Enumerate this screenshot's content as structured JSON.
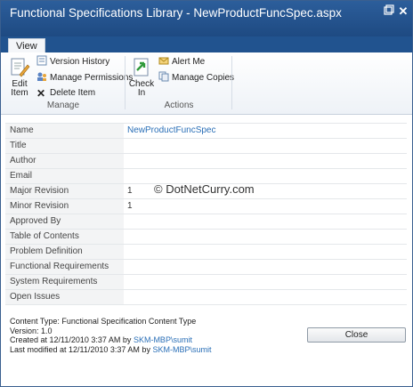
{
  "dialog": {
    "title": "Functional Specifications Library - NewProductFuncSpec.aspx"
  },
  "ribbon": {
    "tab": "View",
    "groups": {
      "manage": {
        "label": "Manage",
        "edit_item": [
          "Edit",
          "Item"
        ],
        "version_history": "Version History",
        "manage_permissions": "Manage Permissions",
        "delete_item": "Delete Item"
      },
      "actions": {
        "label": "Actions",
        "check_in": [
          "Check",
          "In"
        ],
        "alert_me": "Alert Me",
        "manage_copies": "Manage Copies"
      }
    }
  },
  "properties": [
    {
      "label": "Name",
      "value": "NewProductFuncSpec"
    },
    {
      "label": "Title",
      "value": ""
    },
    {
      "label": "Author",
      "value": ""
    },
    {
      "label": "Email",
      "value": ""
    },
    {
      "label": "Major Revision",
      "value": "1"
    },
    {
      "label": "Minor Revision",
      "value": "1"
    },
    {
      "label": "Approved By",
      "value": ""
    },
    {
      "label": "Table of Contents",
      "value": ""
    },
    {
      "label": "Problem Definition",
      "value": ""
    },
    {
      "label": "Functional Requirements",
      "value": ""
    },
    {
      "label": "System Requirements",
      "value": ""
    },
    {
      "label": "Open Issues",
      "value": ""
    }
  ],
  "watermark": "© DotNetCurry.com",
  "footer": {
    "content_type": "Content Type: Functional Specification Content Type",
    "version": "Version: 1.0",
    "created_prefix": "Created at 12/11/2010 3:37 AM by ",
    "created_by": "SKM-MBP\\sumit",
    "modified_prefix": "Last modified at 12/11/2010 3:37 AM by ",
    "modified_by": "SKM-MBP\\sumit"
  },
  "close_label": "Close",
  "colors": {
    "titlebar": "#21538f",
    "link": "#2a6fb7"
  }
}
